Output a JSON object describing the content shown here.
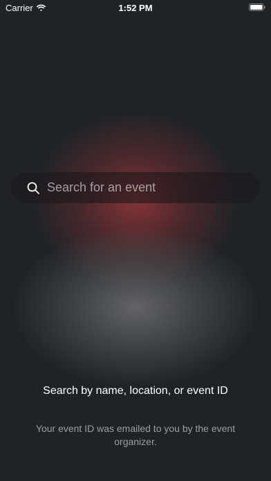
{
  "status_bar": {
    "carrier": "Carrier",
    "time": "1:52 PM",
    "icons": [
      "wifi-icon",
      "battery-icon"
    ]
  },
  "search": {
    "placeholder": "Search for an event",
    "value": "",
    "icon": "search-icon"
  },
  "hint": {
    "title": "Search by name, location, or event ID",
    "subtitle": "Your event ID was emailed to you by the event organizer."
  },
  "colors": {
    "background": "#202326",
    "glow_red": "#96373a",
    "glow_gray": "#78787a",
    "text_primary": "#ffffff",
    "text_secondary": "#9a9a9e"
  }
}
